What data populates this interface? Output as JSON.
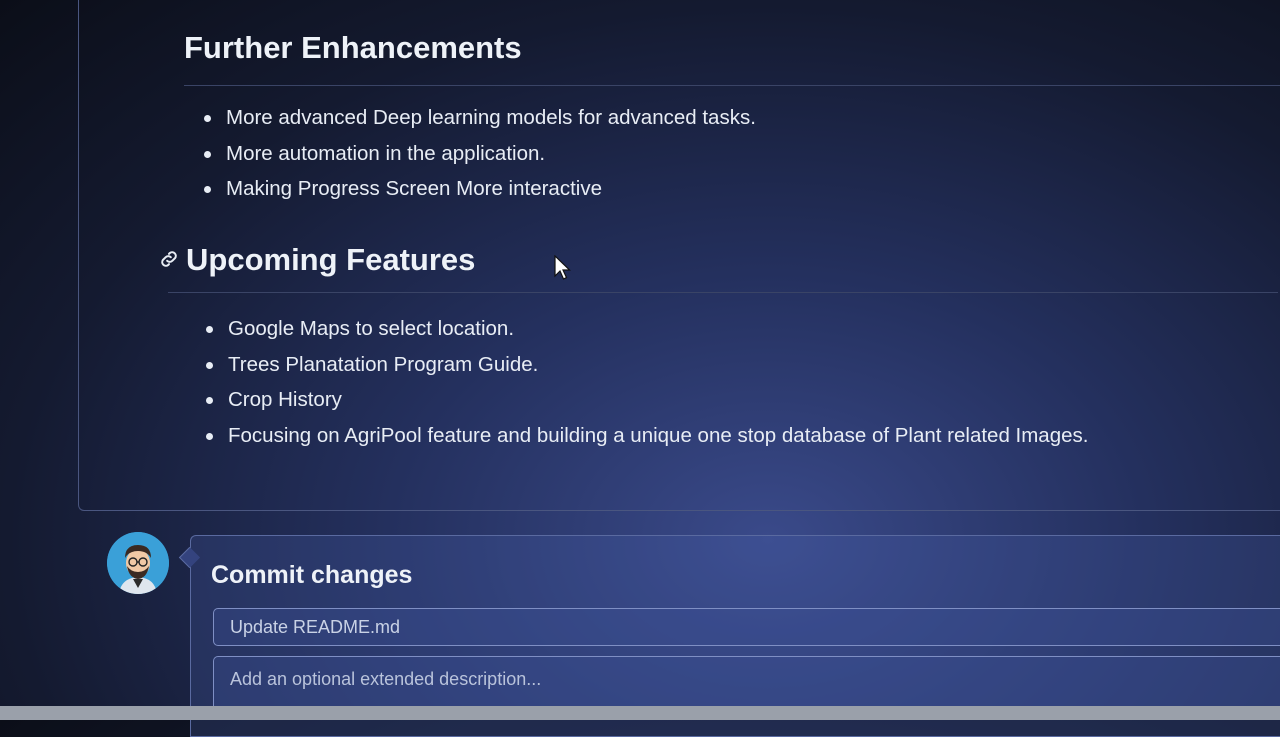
{
  "further_enhancements": {
    "heading": "Further Enhancements",
    "items": [
      "More advanced Deep learning models for advanced tasks.",
      "More automation in the application.",
      "Making Progress Screen More interactive"
    ]
  },
  "upcoming_features": {
    "heading": "Upcoming Features",
    "anchor_icon": "link-icon",
    "items": [
      "Google Maps to select location.",
      "Trees Planatation Program Guide.",
      "Crop History",
      "Focusing on AgriPool feature and building a unique one stop database of Plant related Images."
    ]
  },
  "commit": {
    "title": "Commit changes",
    "summary_value": "Update README.md",
    "description_placeholder": "Add an optional extended description..."
  },
  "colors": {
    "text": "#e8edf5",
    "border": "#4a5680",
    "input_border": "#7f8fc4"
  }
}
